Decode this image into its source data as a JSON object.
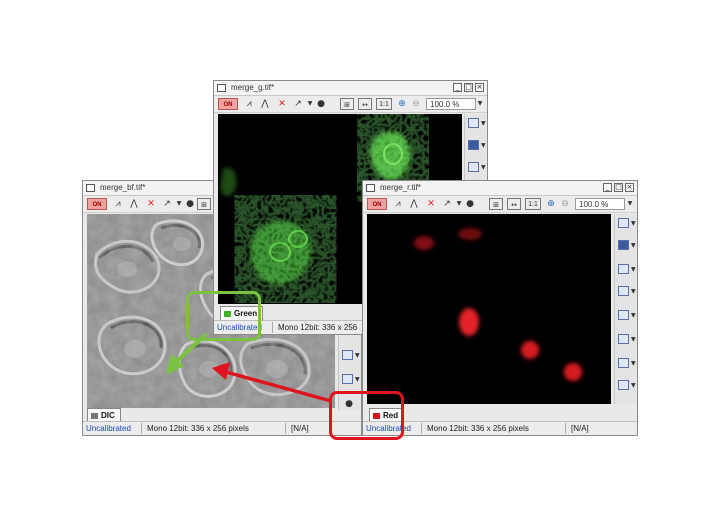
{
  "windows": {
    "dic": {
      "title": "merge_bf.tif*",
      "channel": "DIC",
      "status": {
        "calibration": "Uncalibrated",
        "info": "Mono 12bit: 336 x 256 pixels",
        "value": "[N/A]"
      }
    },
    "green": {
      "title": "merge_g.tif*",
      "channel": "Green",
      "zoom": "100.0 %",
      "ratio_label": "1:1",
      "status": {
        "calibration": "Uncalibrated",
        "info": "Mono 12bit: 336 x 256"
      }
    },
    "red": {
      "title": "merge_r.tif*",
      "channel": "Red",
      "zoom": "100.0 %",
      "ratio_label": "1:1",
      "status": {
        "calibration": "Uncalibrated",
        "info": "Mono 12bit: 336 x 256 pixels",
        "value": "[N/A]"
      }
    }
  },
  "toolbar": {
    "on_label": "ON"
  },
  "colors": {
    "green_highlight": "#7cc242",
    "red_highlight": "#e0141e",
    "green_channel": "#43b02a",
    "red_channel": "#d7141e",
    "calibrated_text": "#1a4bb8"
  },
  "icons": [
    "window-icon",
    "minimize-icon",
    "maximize-icon",
    "close-icon",
    "overlay-on-icon",
    "lut-icon",
    "histogram-icon",
    "delete-icon",
    "select-arrow-icon",
    "fit-icon",
    "zoom-in-icon",
    "zoom-out-icon",
    "dropdown-icon",
    "view-mode-icon",
    "line-profile-icon"
  ]
}
